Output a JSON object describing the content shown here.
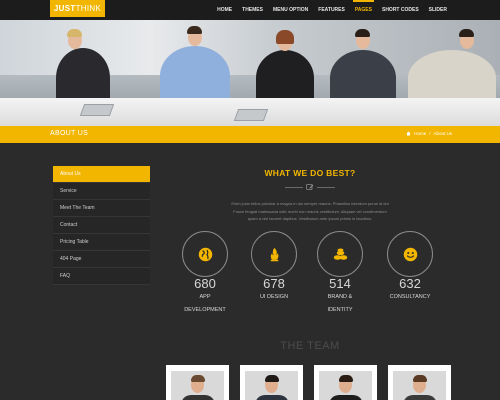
{
  "logo": {
    "bold": "JUST",
    "thin": "THINK"
  },
  "nav": {
    "items": [
      "HOME",
      "THEMES",
      "MENU OPTION",
      "FEATURES",
      "PAGES",
      "SHORT CODES",
      "SLIDER"
    ],
    "active": "PAGES"
  },
  "page_title": "ABOUT US",
  "breadcrumb": {
    "home": "Home",
    "separator": "/",
    "current": "About Us"
  },
  "sidebar": {
    "items": [
      "About Us",
      "Service",
      "Meet The Team",
      "Contact",
      "Pricing Table",
      "404 Page",
      "FAQ"
    ],
    "active": "About Us"
  },
  "section": {
    "title": "WHAT WE DO BEST?",
    "intro_lines": [
      "Enim justo tellus pulvinar a magna in dui semper mauris. Phasellus interdum purus id dui",
      "Fusce feugiat malesuada odio morbi non mauris vestibulum. Aliquam vel condimentum",
      "quam a nisl laoreet dapibus. Vestibulum ante ipsum primis in faucibus."
    ]
  },
  "features": [
    {
      "icon": "globe-icon",
      "number": "680",
      "label_lines": [
        "APP",
        "DEVELOPMENT"
      ]
    },
    {
      "icon": "flame-icon",
      "number": "678",
      "label_lines": [
        "UI DESIGN"
      ]
    },
    {
      "icon": "coins-icon",
      "number": "514",
      "label_lines": [
        "BRAND &",
        "IDENTITY"
      ]
    },
    {
      "icon": "smiley-icon",
      "number": "632",
      "label_lines": [
        "CONSULTANCY"
      ]
    }
  ],
  "team_title": "THE TEAM",
  "colors": {
    "accent": "#f2b600",
    "background": "#2b2b2b",
    "nav_bg": "#1c1c1c"
  }
}
